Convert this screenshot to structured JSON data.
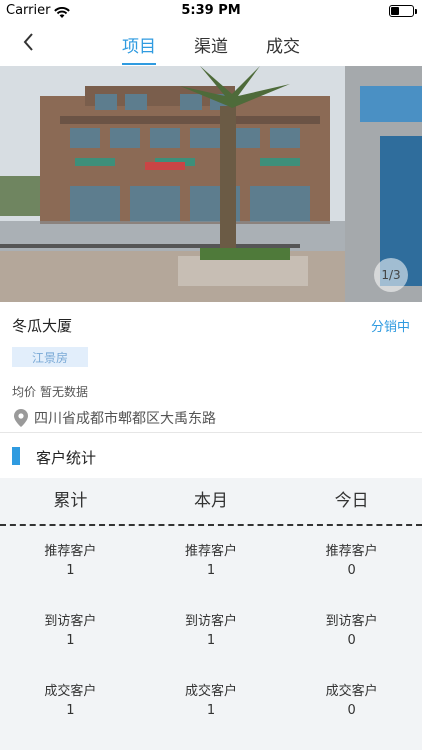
{
  "status_bar": {
    "carrier": "Carrier",
    "time": "5:39 PM"
  },
  "nav": {
    "tabs": [
      {
        "label": "项目",
        "active": true
      },
      {
        "label": "渠道",
        "active": false
      },
      {
        "label": "成交",
        "active": false
      }
    ]
  },
  "hero": {
    "page_indicator": "1/3"
  },
  "project": {
    "name": "冬瓜大厦",
    "status": "分销中",
    "tag": "江景房",
    "price_label": "均价",
    "price_value": "暂无数据",
    "address": "四川省成都市郫都区大禹东路"
  },
  "stats": {
    "section_title": "客户统计",
    "columns": [
      "累计",
      "本月",
      "今日"
    ],
    "rows": [
      {
        "label": "推荐客户",
        "values": [
          "1",
          "1",
          "0"
        ]
      },
      {
        "label": "到访客户",
        "values": [
          "1",
          "1",
          "0"
        ]
      },
      {
        "label": "成交客户",
        "values": [
          "1",
          "1",
          "0"
        ]
      }
    ]
  },
  "colors": {
    "accent": "#2f9be0",
    "tag_bg": "#e2eefb",
    "stats_bg": "#f2f4f6"
  }
}
